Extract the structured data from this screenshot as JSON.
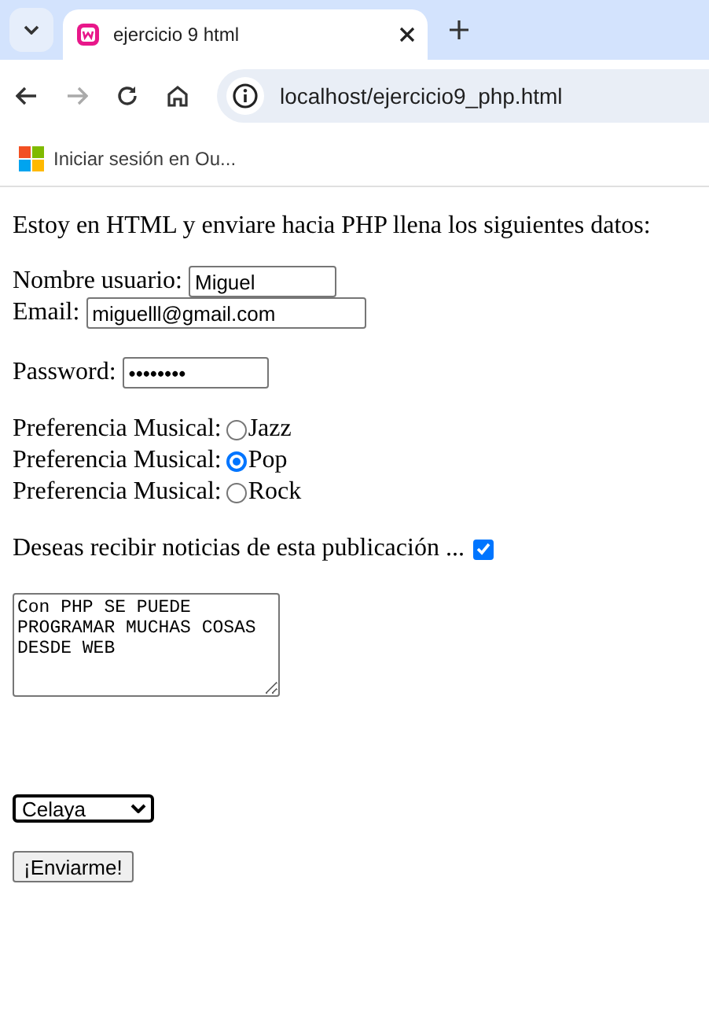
{
  "browser": {
    "tab_title": "ejercicio 9 html",
    "address": "localhost/ejercicio9_php.html",
    "bookmark": "Iniciar sesión en Ou..."
  },
  "page": {
    "intro": "Estoy en HTML y enviare hacia PHP llena los siguientes datos:",
    "username": {
      "label": "Nombre usuario:",
      "value": "Miguel"
    },
    "email": {
      "label": "Email:",
      "value": "miguelll@gmail.com"
    },
    "password": {
      "label": "Password:",
      "value": "••••••••"
    },
    "radios": [
      {
        "label": "Preferencia Musical:",
        "option": "Jazz",
        "selected": false
      },
      {
        "label": "Preferencia Musical:",
        "option": "Pop",
        "selected": true
      },
      {
        "label": "Preferencia Musical:",
        "option": "Rock",
        "selected": false
      }
    ],
    "newsletter": {
      "label": "Deseas recibir noticias de esta publicación ...",
      "checked": true
    },
    "comments": {
      "value": "Con PHP SE PUEDE PROGRAMAR MUCHAS COSAS DESDE WEB"
    },
    "city": {
      "value": "Celaya"
    },
    "submit": "¡Enviarme!"
  }
}
